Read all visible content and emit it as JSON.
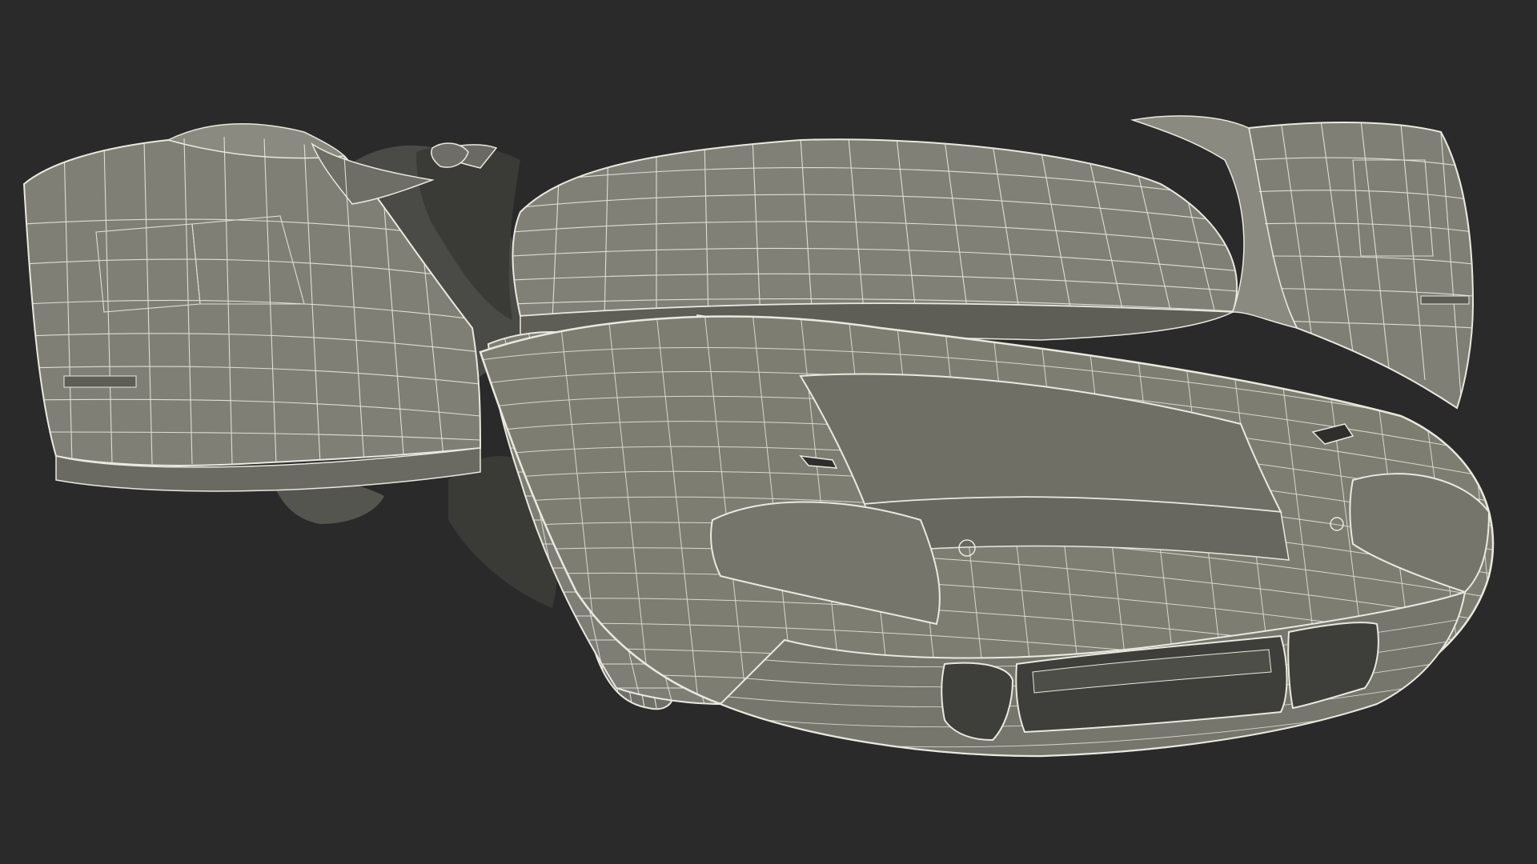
{
  "scene": {
    "subject": "car-wireframe",
    "colors": {
      "background": "#2a2a2a",
      "body_fill": "#7d7d72",
      "body_shade": "#6b6b62",
      "panel_dark": "#5a5a54",
      "wire": "#e9e9df",
      "cavity": "#3e3e3a"
    }
  }
}
